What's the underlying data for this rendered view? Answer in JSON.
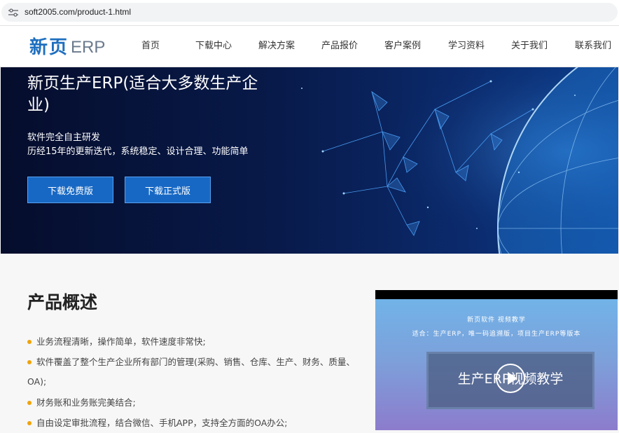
{
  "browser": {
    "url": "soft2005.com/product-1.html",
    "site_info_icon": "tune-icon"
  },
  "nav": {
    "logo_cn": "新页",
    "logo_en": "ERP",
    "items": [
      "首页",
      "下载中心",
      "解决方案",
      "产品报价",
      "客户案例",
      "学习资料",
      "关于我们",
      "联系我们"
    ]
  },
  "hero": {
    "title": "新页生产ERP(适合大多数生产企业)",
    "subtitle1": "软件完全自主研发",
    "subtitle2": "历经15年的更新迭代，系统稳定、设计合理、功能简单",
    "btn_free": "下载免费版",
    "btn_official": "下载正式版"
  },
  "overview": {
    "title": "产品概述",
    "features": [
      "业务流程清晰，操作简单，软件速度非常快;",
      "软件覆盖了整个生产企业所有部门的管理(采购、销售、仓库、生产、财务、质量、OA);",
      "财务账和业务账完美结合;",
      "自由设定审批流程，结合微信、手机APP，支持全方面的OA办公;"
    ]
  },
  "video": {
    "line1": "新页软件 视频教学",
    "line2": "适合：生产ERP，唯一码追溯版，项目生产ERP等版本",
    "title": "生产ERP视频教学",
    "play_icon": "play-icon"
  },
  "colors": {
    "brand_blue": "#1e6fbf",
    "button_blue": "#1768c4",
    "bullet_orange": "#f0a30a",
    "hero_bg": "#081a4a"
  }
}
